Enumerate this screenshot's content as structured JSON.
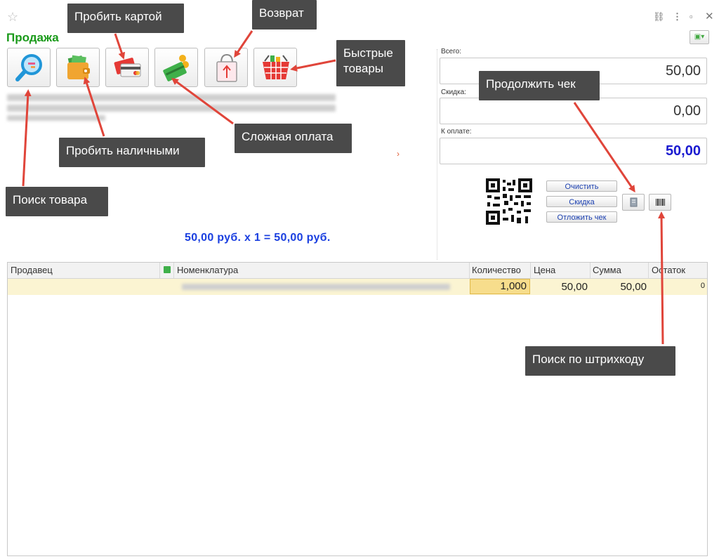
{
  "window": {
    "title": "Продажа",
    "star_icon": "star-icon",
    "controls": [
      "link-icon",
      "more-icon",
      "restore-icon",
      "close-icon"
    ]
  },
  "toolbar": {
    "buttons": [
      {
        "name": "search-product-button",
        "icon": "magnifier-icon"
      },
      {
        "name": "pay-cash-button",
        "icon": "wallet-icon"
      },
      {
        "name": "pay-card-button",
        "icon": "card-icon"
      },
      {
        "name": "complex-payment-button",
        "icon": "coins-card-icon"
      },
      {
        "name": "return-button",
        "icon": "bag-return-icon"
      },
      {
        "name": "quick-goods-button",
        "icon": "basket-icon"
      }
    ]
  },
  "summary_line": "50,00 руб. x 1  = 50,00 руб.",
  "totals": {
    "total_label": "Всего:",
    "total_value": "50,00",
    "discount_label": "Скидка:",
    "discount_value": "0,00",
    "to_pay_label": "К оплате:",
    "to_pay_value": "50,00"
  },
  "actions": {
    "clear": "Очистить",
    "discount": "Скидка",
    "postpone": "Отложить чек"
  },
  "table": {
    "columns": [
      "Продавец",
      "Номенклатура",
      "Количество",
      "Цена",
      "Сумма",
      "Остаток"
    ],
    "rows": [
      {
        "seller": "",
        "item": "",
        "quantity": "1,000",
        "price": "50,00",
        "sum": "50,00",
        "stock": "0"
      }
    ]
  },
  "annotations": {
    "pay_card": "Пробить картой",
    "return": "Возврат",
    "quick_goods": "Быстрые товары",
    "continue_check": "Продолжить чек",
    "pay_cash": "Пробить наличными",
    "complex_payment": "Сложная оплата",
    "search_product": "Поиск товара",
    "barcode_search": "Поиск по штрихкоду"
  },
  "colors": {
    "title": "#1a9a1a",
    "pay_value": "#1a1ad0",
    "row_highlight": "#fbf4d2",
    "annotation_bg": "#4a4a4a",
    "arrow": "#e0453a"
  }
}
